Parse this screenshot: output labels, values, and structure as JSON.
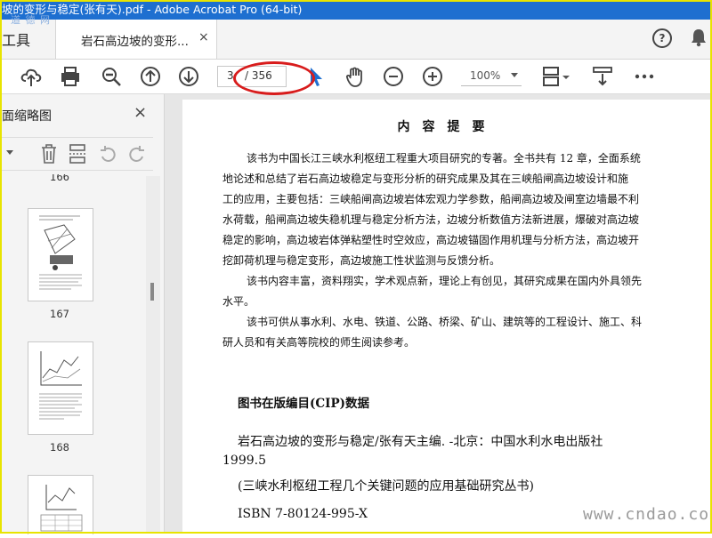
{
  "window": {
    "title": "坡的变形与稳定(张有天).pdf - Adobe Acrobat Pro (64-bit)",
    "watermark_top": "道  德  网"
  },
  "tabs": {
    "tools": "工具",
    "document": "岩石高边坡的变形...",
    "close": "×"
  },
  "topbar": {
    "help_icon": "help-icon",
    "bell_icon": "bell-icon"
  },
  "toolbar": {
    "page_current": "3",
    "page_total": "/ 356",
    "zoom": "100%",
    "icons": [
      "upload-icon",
      "print-icon",
      "zoom-out-magnifier-icon",
      "page-up-icon",
      "page-down-icon",
      "select-cursor-icon",
      "hand-icon",
      "zoom-out-icon",
      "zoom-in-icon",
      "page-view-icon",
      "scroll-mode-icon",
      "more-icon"
    ],
    "highlight_color": "#d81c1c"
  },
  "left_panel": {
    "title": "面缩略图",
    "close": "×",
    "thumbnails": [
      {
        "label": "166"
      },
      {
        "label": "167"
      },
      {
        "label": "168"
      }
    ]
  },
  "document": {
    "heading": "内容提要",
    "paragraphs": [
      "该书为中国长江三峡水利枢纽工程重大项目研究的专著。全书共有 12 章，全面系统",
      "地论述和总结了岩石高边坡稳定与变形分析的研究成果及其在三峡船闸高边坡设计和施",
      "工的应用，主要包括：三峡船闸高边坡岩体宏观力学参数，船闸高边坡及闸室边墙最不利",
      "水荷载，船闸高边坡失稳机理与稳定分析方法，边坡分析数值方法新进展，爆破对高边坡",
      "稳定的影响，高边坡岩体弹粘塑性时空效应，高边坡锚固作用机理与分析方法，高边坡开",
      "挖卸荷机理与稳定变形，高边坡施工性状监测与反馈分析。",
      "该书内容丰富，资料翔实，学术观点新，理论上有创见，其研究成果在国内外具领先",
      "水平。",
      "该书可供从事水利、水电、铁道、公路、桥梁、矿山、建筑等的工程设计、施工、科",
      "研人员和有关高等院校的师生阅读参考。"
    ],
    "cip_title": "图书在版编目(CIP)数据",
    "cip_lines": [
      "岩石高边坡的变形与稳定/张有天主编. -北京：中国水利水电出版社",
      "1999.5",
      "(三峡水利枢纽工程几个关键问题的应用基础研究丛书)",
      "ISBN 7-80124-995-X"
    ]
  },
  "watermark_bottom": "www.cndao.com"
}
